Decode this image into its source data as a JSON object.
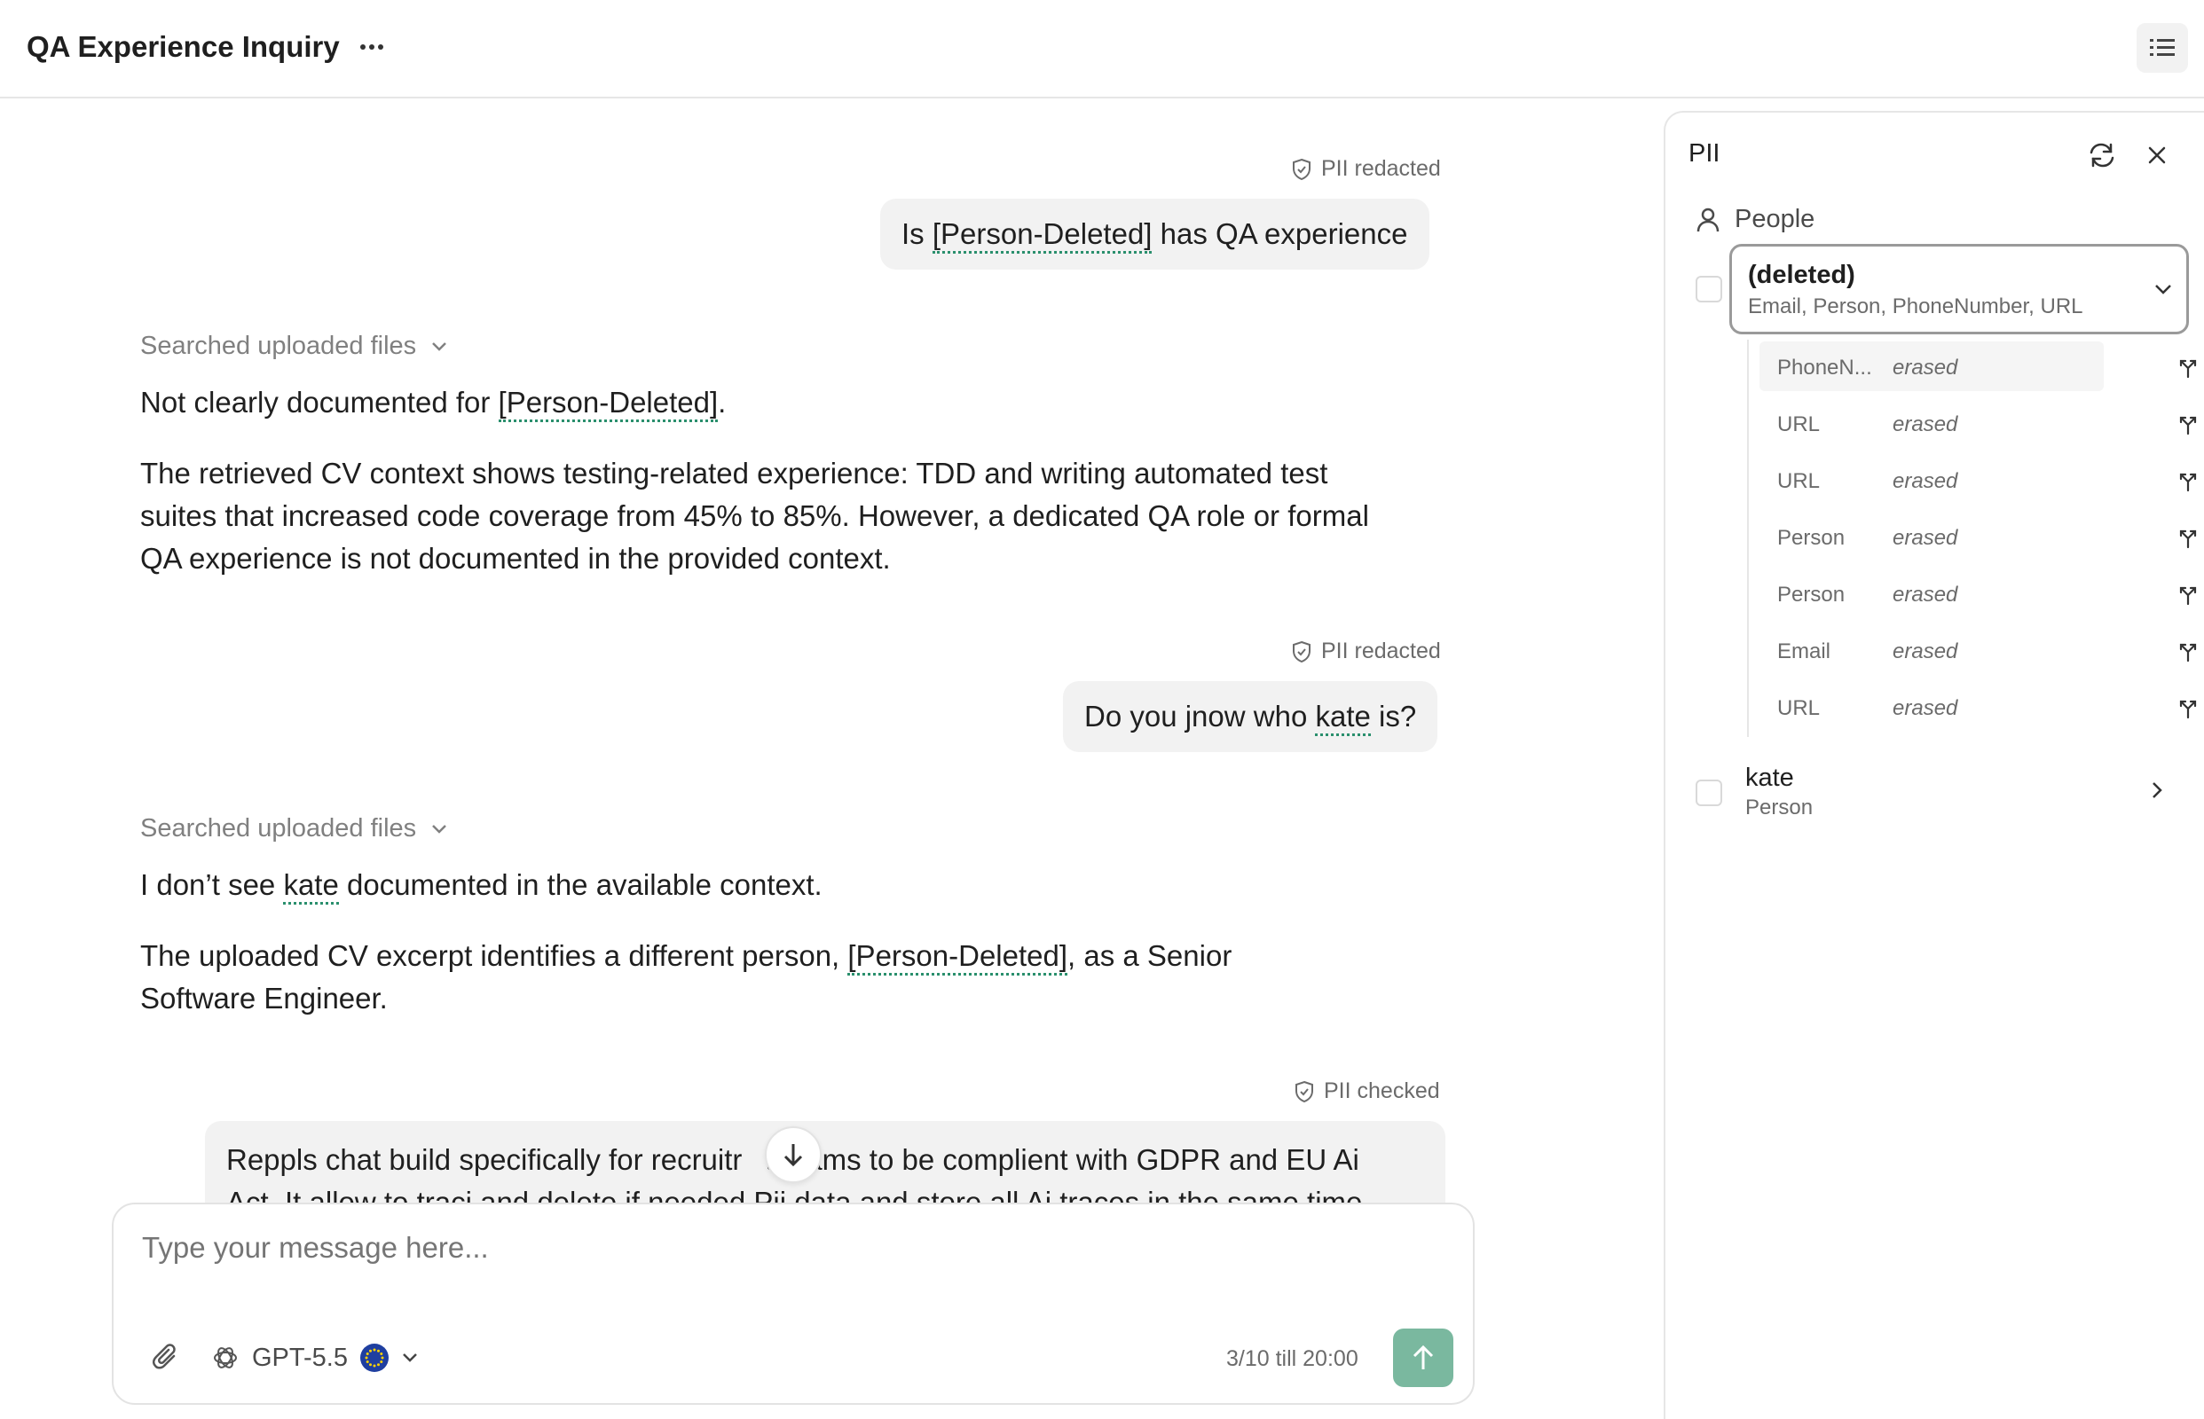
{
  "header": {
    "title": "QA Experience Inquiry",
    "more_icon": "ellipsis-icon",
    "toc_icon": "list-icon"
  },
  "messages": [
    {
      "role": "user",
      "tag": "PII redacted",
      "text_before": "Is ",
      "redacted": "[Person-Deleted]",
      "text_after": " has QA experience"
    },
    {
      "role": "assistant",
      "searched": "Searched uploaded files",
      "p1_before": "Not clearly documented for ",
      "p1_redacted": "[Person-Deleted]",
      "p1_after": ".",
      "p2": "The retrieved CV context shows testing-related experience: TDD and writing automated test suites that increased code coverage from 45% to 85%. However, a dedicated QA role or formal QA experience is not documented in the provided context."
    },
    {
      "role": "user",
      "tag": "PII redacted",
      "text_before": "Do you jnow who ",
      "redacted": "kate",
      "text_after": " is?"
    },
    {
      "role": "assistant",
      "searched": "Searched uploaded files",
      "p1_before": "I don’t see ",
      "p1_redacted": "kate",
      "p1_after": " documented in the available context.",
      "p2_before": "The uploaded CV excerpt identifies a different person, ",
      "p2_redacted": "[Person-Deleted]",
      "p2_after": ", as a Senior Software Engineer."
    },
    {
      "role": "user",
      "tag": "PII checked",
      "line1_a": "Reppls chat build specifically for recruitr",
      "line1_b": "t teams to be complient with GDPR and EU Ai",
      "line2": "Act. It allow to traci and delete if needed Pii data and store all Ai traces in the same time -"
    }
  ],
  "composer": {
    "placeholder": "Type your message here...",
    "model": "GPT-5.5",
    "quota": "3/10 till 20:00"
  },
  "panel": {
    "title": "PII",
    "group": "People",
    "entities": [
      {
        "name": "(deleted)",
        "types": "Email, Person, PhoneNumber, URL",
        "expanded": true,
        "items": [
          {
            "type": "PhoneN...",
            "value": "erased"
          },
          {
            "type": "URL",
            "value": "erased"
          },
          {
            "type": "URL",
            "value": "erased"
          },
          {
            "type": "Person",
            "value": "erased"
          },
          {
            "type": "Person",
            "value": "erased"
          },
          {
            "type": "Email",
            "value": "erased"
          },
          {
            "type": "URL",
            "value": "erased"
          }
        ]
      },
      {
        "name": "kate",
        "types": "Person",
        "expanded": false
      }
    ]
  },
  "colors": {
    "accent": "#7ab89f",
    "redact_underline": "#2a8f6d",
    "bubble_bg": "#f2f2f2"
  }
}
